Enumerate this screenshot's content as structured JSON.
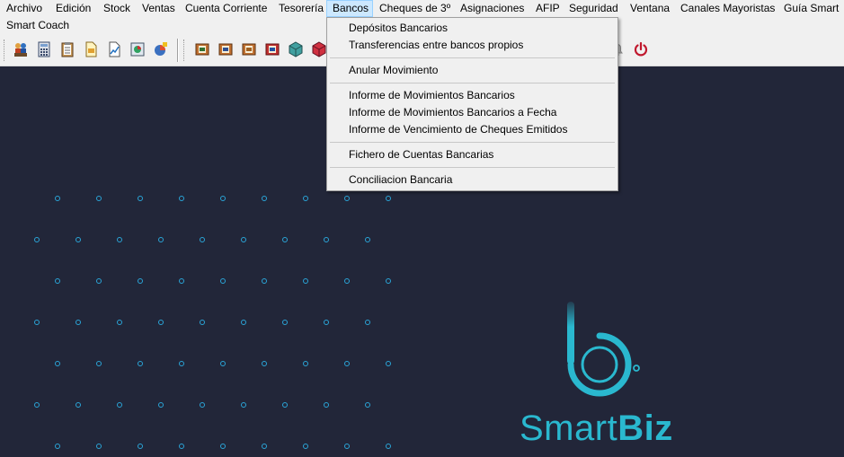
{
  "menubar": {
    "items": [
      "Archivo",
      "Edición",
      "Stock",
      "Ventas",
      "Cuenta Corriente",
      "Tesorería",
      "Bancos",
      "Cheques de 3º",
      "Asignaciones",
      "AFIP",
      "Seguridad",
      "Ventana",
      "Canales Mayoristas",
      "Guía Smart",
      "Smart Coach"
    ],
    "active": "Bancos"
  },
  "dropdown": {
    "items": [
      "Depósitos Bancarios",
      "Transferencias entre bancos propios",
      "Anular Movimiento",
      "Informe de Movimientos Bancarios",
      "Informe de Movimientos Bancarios a Fecha",
      "Informe de Vencimiento de Cheques Emitidos",
      "Fichero de Cuentas Bancarias",
      "Conciliacion Bancaria"
    ]
  },
  "toolbar": {
    "icons": [
      "users-icon",
      "calculator-icon",
      "clipboard-icon",
      "document-icon",
      "chart-icon",
      "report-icon",
      "pie-chart-icon",
      "book-icon",
      "book-icon",
      "book-icon",
      "book-red-icon",
      "cube-icon",
      "cube-red-icon",
      "bell-icon",
      "power-icon"
    ]
  },
  "brand": {
    "name_light": "Smart",
    "name_bold": "Biz",
    "color": "#2ab8cf",
    "background": "#222639"
  },
  "colors": {
    "dots": "#2aa5d8",
    "power": "#c0182d"
  }
}
